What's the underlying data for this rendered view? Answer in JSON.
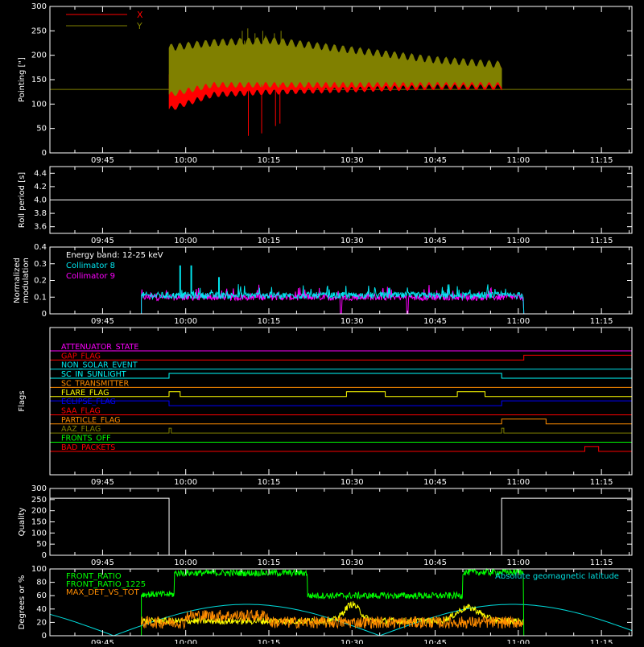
{
  "colors": {
    "background": "#000000",
    "axes": "#ffffff",
    "x_series": "#ff0000",
    "y_series": "#808000",
    "collimator8": "#00e5ee",
    "collimator9": "#ff00ff",
    "front_ratio": "#00ff00",
    "front_ratio_1225": "#ffff00",
    "max_det": "#ff8c00",
    "geomag": "#00dddd"
  },
  "time_axis": {
    "ticks": [
      "09:45",
      "10:00",
      "10:15",
      "10:30",
      "10:45",
      "11:00",
      "11:15"
    ],
    "range_minutes": [
      580,
      440,
      400,
      360,
      320,
      280,
      240
    ]
  },
  "chart_data": [
    {
      "type": "line",
      "ylabel": "Pointing [\"]",
      "ylim": [
        0,
        300
      ],
      "yticks": [
        "0",
        "50",
        "100",
        "150",
        "200",
        "250",
        "300"
      ],
      "grid": false,
      "legend": "top-left",
      "series": [
        {
          "name": "X",
          "color": "#ff0000",
          "x": [
            "09:57",
            "10:05",
            "10:15",
            "10:30",
            "10:45",
            "10:57"
          ],
          "low": [
            90,
            120,
            125,
            130,
            135,
            135
          ],
          "high": [
            160,
            165,
            175,
            180,
            180,
            180
          ]
        },
        {
          "name": "Y",
          "color": "#808000",
          "x": [
            "09:57",
            "10:05",
            "10:15",
            "10:30",
            "10:45",
            "10:57"
          ],
          "low": [
            120,
            140,
            140,
            140,
            140,
            140
          ],
          "high": [
            215,
            225,
            230,
            210,
            190,
            180
          ]
        }
      ],
      "reference_line": 130
    },
    {
      "type": "line",
      "ylabel": "Roll period [s]",
      "ylim": [
        3.5,
        4.5
      ],
      "yticks": [
        "3.6",
        "3.8",
        "4.0",
        "4.2",
        "4.4"
      ],
      "series": [
        {
          "name": "",
          "values": [
            4.0
          ]
        }
      ]
    },
    {
      "type": "line",
      "ylabel": "Normalized modulation",
      "ylim": [
        0,
        0.4
      ],
      "yticks": [
        "0",
        "0.1",
        "0.2",
        "0.3",
        "0.4"
      ],
      "legend_title": "Energy band: 12-25 keV",
      "legend": "top-left",
      "series": [
        {
          "name": "Collimator 8",
          "color": "#00e5ee",
          "typical": 0.11,
          "peaks": [
            0.29,
            0.29,
            0.22
          ]
        },
        {
          "name": "Collimator 9",
          "color": "#ff00ff",
          "typical": 0.1
        }
      ]
    },
    {
      "type": "line",
      "ylabel": "Flags",
      "flags": [
        {
          "name": "ATTENUATOR_STATE",
          "color": "#ff00ff"
        },
        {
          "name": "GAP_FLAG",
          "color": "#ff0000"
        },
        {
          "name": "NON_SOLAR_EVENT",
          "color": "#00e5ee"
        },
        {
          "name": "SC_IN_SUNLIGHT",
          "color": "#00ffff"
        },
        {
          "name": "SC_TRANSMITTER",
          "color": "#ff8c00"
        },
        {
          "name": "FLARE_FLAG",
          "color": "#ffff00"
        },
        {
          "name": "ECLIPSE_FLAG",
          "color": "#0000ff"
        },
        {
          "name": "SAA_FLAG",
          "color": "#ff0000"
        },
        {
          "name": "PARTICLE_FLAG",
          "color": "#ff8c00"
        },
        {
          "name": "AAZ_FLAG",
          "color": "#808000"
        },
        {
          "name": "FRONTS_OFF",
          "color": "#00ff00"
        },
        {
          "name": "BAD_PACKETS",
          "color": "#ff0000"
        }
      ]
    },
    {
      "type": "line",
      "ylabel": "Quality",
      "ylim": [
        0,
        300
      ],
      "yticks": [
        "0",
        "50",
        "100",
        "150",
        "200",
        "250",
        "300"
      ],
      "series": [
        {
          "name": "",
          "values": [
            256,
            0,
            256
          ]
        }
      ]
    },
    {
      "type": "line",
      "ylabel": "Degrees or %",
      "ylim": [
        0,
        100
      ],
      "yticks": [
        "0",
        "20",
        "40",
        "60",
        "80",
        "100"
      ],
      "legend": "top-left",
      "series": [
        {
          "name": "FRONT_RATIO",
          "color": "#00ff00"
        },
        {
          "name": "FRONT_RATIO_1225",
          "color": "#ffff00"
        },
        {
          "name": "MAX_DET_VS_TOT",
          "color": "#ff8c00"
        },
        {
          "name": "Absolute geomagnetic latitude",
          "color": "#00dddd"
        }
      ]
    }
  ]
}
